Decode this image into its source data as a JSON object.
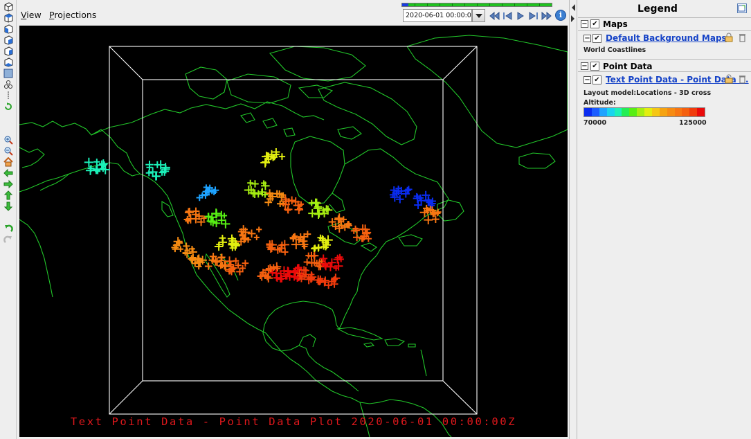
{
  "menu": {
    "view": "View",
    "projections": "Projections"
  },
  "time": {
    "current": "2020-06-01 00:00:00Z",
    "progress_fraction": 0.04
  },
  "anim_buttons": [
    "first-frame-icon",
    "step-back-icon",
    "play-icon",
    "step-forward-icon",
    "last-frame-icon"
  ],
  "map": {
    "title": "Text Point Data - Point Data Plot 2020-06-01 00:00:00Z",
    "coast_color": "#22c72a",
    "box_color": "#ffffff",
    "title_color": "#e0181c",
    "marker": "3D cross",
    "stations": [
      {
        "lon": -101.0,
        "lat": 60.0,
        "alt": 100000
      },
      {
        "lon": -118.0,
        "lat": 52.0,
        "alt": 80000
      },
      {
        "lon": -114.0,
        "lat": 45.0,
        "alt": 92000
      },
      {
        "lon": -98.0,
        "lat": 49.0,
        "alt": 108000
      },
      {
        "lon": -86.0,
        "lat": 47.0,
        "alt": 95000
      },
      {
        "lon": -79.5,
        "lat": 43.5,
        "alt": 112000
      },
      {
        "lon": -64.0,
        "lat": 52.0,
        "alt": 70000
      },
      {
        "lon": -57.5,
        "lat": 51.0,
        "alt": 72000
      },
      {
        "lon": -55.0,
        "lat": 47.5,
        "alt": 112000
      },
      {
        "lon": -122.0,
        "lat": 38.0,
        "alt": 108000
      },
      {
        "lon": -117.0,
        "lat": 34.0,
        "alt": 110000
      },
      {
        "lon": -112.0,
        "lat": 33.5,
        "alt": 114000
      },
      {
        "lon": -104.0,
        "lat": 40.0,
        "alt": 112000
      },
      {
        "lon": -96.0,
        "lat": 36.5,
        "alt": 115000
      },
      {
        "lon": -90.0,
        "lat": 38.5,
        "alt": 114000
      },
      {
        "lon": -85.0,
        "lat": 33.5,
        "alt": 118000
      },
      {
        "lon": -80.0,
        "lat": 33.5,
        "alt": 122000
      },
      {
        "lon": -80.5,
        "lat": 28.0,
        "alt": 119000
      },
      {
        "lon": -90.0,
        "lat": 30.0,
        "alt": 124000
      },
      {
        "lon": -97.0,
        "lat": 30.0,
        "alt": 117000
      },
      {
        "lon": -93.5,
        "lat": 29.0,
        "alt": 123000
      },
      {
        "lon": -86.0,
        "lat": 30.0,
        "alt": 120000
      },
      {
        "lon": -150.0,
        "lat": 61.0,
        "alt": 86000
      },
      {
        "lon": -133.0,
        "lat": 58.5,
        "alt": 84000
      },
      {
        "lon": -104.0,
        "lat": 52.0,
        "alt": 95000
      },
      {
        "lon": -93.5,
        "lat": 47.5,
        "alt": 116000
      },
      {
        "lon": -84.0,
        "lat": 38.0,
        "alt": 100000
      },
      {
        "lon": -73.0,
        "lat": 41.5,
        "alt": 116000
      },
      {
        "lon": -120.0,
        "lat": 46.0,
        "alt": 112000
      },
      {
        "lon": -110.0,
        "lat": 38.5,
        "alt": 100000
      },
      {
        "lon": -106.0,
        "lat": 32.0,
        "alt": 116000
      }
    ]
  },
  "legend": {
    "title": "Legend",
    "maps_group": "Maps",
    "default_maps_link": "Default Background Maps",
    "world_coastlines": "World Coastlines",
    "point_group": "Point Data",
    "point_link": "Text Point Data - Point Data ...",
    "layout_model": "Layout model:Locations - 3D cross",
    "altitude_label": "Altitude:",
    "range_min": "70000",
    "range_max": "125000",
    "range_min_value": 70000,
    "range_max_value": 125000,
    "colors": [
      "#0a2cf0",
      "#1b5cff",
      "#1ea3ff",
      "#18d4ee",
      "#1bf0b8",
      "#22ee55",
      "#57ee14",
      "#a6ee12",
      "#e2ee10",
      "#f5c714",
      "#f5a311",
      "#f68b12",
      "#f77612",
      "#f5600f",
      "#f03b0c",
      "#ea0a0a"
    ]
  }
}
